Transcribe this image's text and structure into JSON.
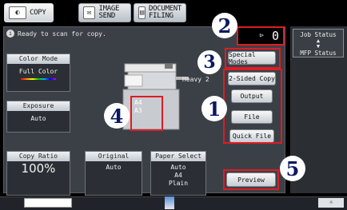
{
  "tabs": [
    {
      "label": "COPY",
      "icon": "copy-icon",
      "active": true
    },
    {
      "label": "IMAGE SEND",
      "icon": "image-send-icon",
      "active": false
    },
    {
      "label": "DOCUMENT\nFILING",
      "icon": "document-filing-icon",
      "active": false
    }
  ],
  "status": {
    "message": "Ready to scan for copy."
  },
  "counter": {
    "value": "0"
  },
  "job_status": {
    "line1": "Job Status",
    "arrows": "▲\n▼",
    "line2": "MFP Status"
  },
  "color_mode": {
    "header": "Color Mode",
    "value": "Full Color"
  },
  "exposure": {
    "header": "Exposure",
    "value": "Auto"
  },
  "copy_ratio": {
    "header": "Copy Ratio",
    "value": "100%"
  },
  "original": {
    "header": "Original",
    "value": "Auto"
  },
  "paper_select": {
    "header": "Paper Select",
    "value": "Auto\nA4\nPlain"
  },
  "machine": {
    "tray_label": "Heavy 2",
    "paper_a4": "A4",
    "paper_a3": "A3"
  },
  "right_buttons": {
    "special_modes": "Special Modes",
    "two_sided": "2-Sided Copy",
    "output": "Output",
    "file": "File",
    "quick_file": "Quick File"
  },
  "preview": {
    "label": "Preview"
  },
  "callouts": [
    "1",
    "2",
    "3",
    "4",
    "5"
  ],
  "colors": {
    "highlight": "#e01b24",
    "callout_text": "#0a1860",
    "panel": "#3b4047"
  }
}
